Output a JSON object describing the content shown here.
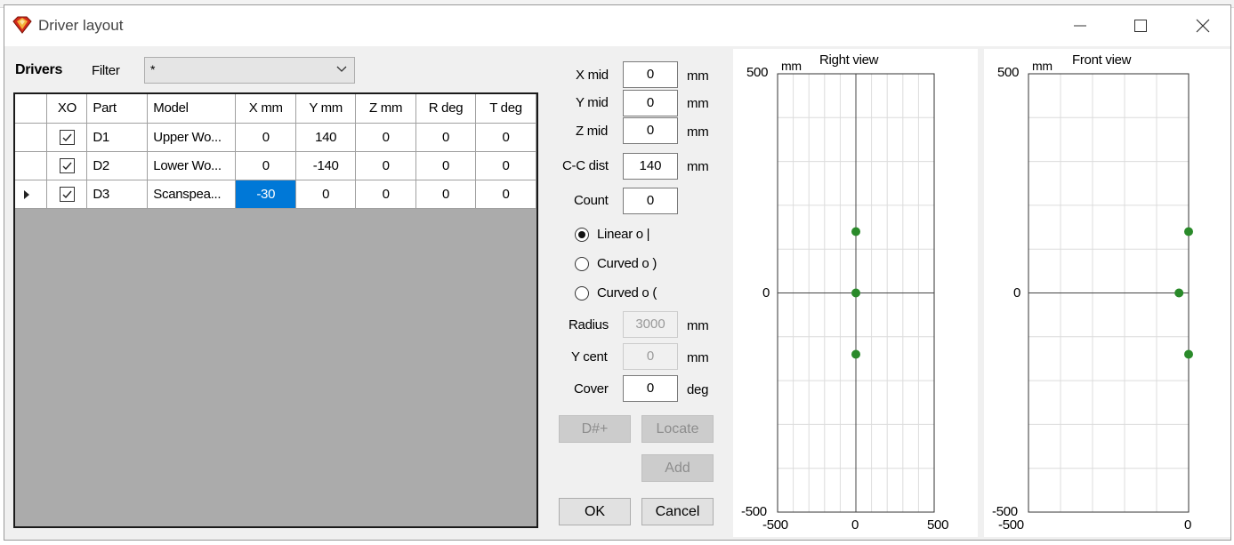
{
  "window": {
    "title": "Driver layout",
    "icon": "app-diamond-icon",
    "controls": [
      "minimize-icon",
      "maximize-icon",
      "close-icon"
    ]
  },
  "drivers_panel": {
    "label": "Drivers",
    "filter_label": "Filter",
    "filter_value": "*",
    "table": {
      "columns": [
        "XO",
        "Part",
        "Model",
        "X mm",
        "Y mm",
        "Z mm",
        "R deg",
        "T deg"
      ],
      "rows": [
        {
          "xo": true,
          "part": "D1",
          "model": "Upper Wo...",
          "x": "0",
          "y": "140",
          "z": "0",
          "r": "0",
          "t": "0"
        },
        {
          "xo": true,
          "part": "D2",
          "model": "Lower Wo...",
          "x": "0",
          "y": "-140",
          "z": "0",
          "r": "0",
          "t": "0"
        },
        {
          "xo": true,
          "part": "D3",
          "model": "Scanspea...",
          "x": "-30",
          "y": "0",
          "z": "0",
          "r": "0",
          "t": "0"
        }
      ]
    }
  },
  "settings": {
    "x_mid": {
      "label": "X mid",
      "value": "0",
      "unit": "mm"
    },
    "y_mid": {
      "label": "Y mid",
      "value": "0",
      "unit": "mm"
    },
    "z_mid": {
      "label": "Z mid",
      "value": "0",
      "unit": "mm"
    },
    "cc_dist": {
      "label": "C-C dist",
      "value": "140",
      "unit": "mm"
    },
    "count": {
      "label": "Count",
      "value": "0"
    },
    "layout_options": [
      {
        "label": "Linear  o |",
        "selected": true
      },
      {
        "label": "Curved  o )",
        "selected": false
      },
      {
        "label": "Curved  o (",
        "selected": false
      }
    ],
    "radius": {
      "label": "Radius",
      "value": "3000",
      "unit": "mm"
    },
    "y_cent": {
      "label": "Y cent",
      "value": "0",
      "unit": "mm"
    },
    "cover": {
      "label": "Cover",
      "value": "0",
      "unit": "deg"
    }
  },
  "buttons": {
    "dnum": "D#+",
    "locate": "Locate",
    "add": "Add",
    "ok": "OK",
    "cancel": "Cancel"
  },
  "views": {
    "right": {
      "title": "Right view",
      "unit": "mm",
      "y_top": "500",
      "y_mid": "0",
      "y_bottom": "-500",
      "x_left": "-500",
      "x_mid": "0",
      "x_right": "500"
    },
    "front": {
      "title": "Front view",
      "unit": "mm",
      "y_top": "500",
      "y_mid": "0",
      "y_bottom": "-500",
      "x_left": "-500",
      "x_right": "0"
    }
  },
  "chart_data": [
    {
      "type": "scatter",
      "title": "Right view",
      "xlim": [
        -500,
        500
      ],
      "ylim": [
        -500,
        500
      ],
      "x": [
        0,
        0,
        0
      ],
      "y": [
        140,
        0,
        -140
      ],
      "color": "#2a8a2a"
    },
    {
      "type": "scatter",
      "title": "Front view",
      "xlim": [
        -500,
        0
      ],
      "ylim": [
        -500,
        500
      ],
      "x": [
        0,
        -30,
        0
      ],
      "y": [
        140,
        0,
        -140
      ],
      "color": "#2a8a2a"
    }
  ]
}
